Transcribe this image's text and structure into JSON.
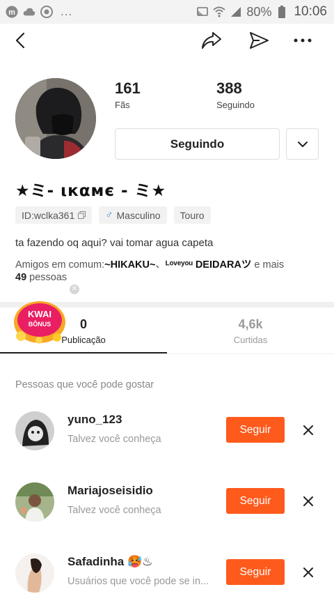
{
  "status_bar": {
    "battery_text": "80%",
    "time": "10:06",
    "dots": "...",
    "left_icons": [
      "messenger-icon",
      "cloud-icon",
      "chrome-icon"
    ],
    "right_icons": [
      "cast-icon",
      "wifi-icon",
      "signal-icon",
      "battery-icon"
    ]
  },
  "header": {
    "icons": [
      "back-icon",
      "share-icon",
      "send-icon",
      "more-icon"
    ]
  },
  "profile": {
    "followers_count": "161",
    "followers_label": "Fãs",
    "following_count": "388",
    "following_label": "Seguindo",
    "follow_button_label": "Seguindo",
    "username": "★ミ- ιкαмє - ミ★",
    "tags": {
      "id": "ID:wclka361",
      "gender_symbol": "♂",
      "gender": "Masculino",
      "sign": "Touro"
    },
    "bio": "ta fazendo oq aqui? vai tomar agua capeta",
    "mutual_friends": {
      "prefix": "Amigos em comum:",
      "friend_1": "~HIKAKU~",
      "separator": "、",
      "friend_2_small": "ᴸᵒᵛᵉ",
      "friend_2_small_b": "ʸᵒᵘ",
      "friend_2": "DEIDARA",
      "friend_2_suffix": "ツ",
      "and_more": " e mais",
      "count": "49",
      "people": " pessoas"
    }
  },
  "tabs": [
    {
      "count": "0",
      "label": "Publicação",
      "active": true
    },
    {
      "count": "4,6k",
      "label": "Curtidas",
      "active": false
    }
  ],
  "kwai_bonus": {
    "line1": "KWAI",
    "line2": "BÔNUS"
  },
  "suggestions": {
    "title": "Pessoas que você pode gostar",
    "button_label": "Seguir",
    "accent_color": "#fe5a1c",
    "items": [
      {
        "name": "yuno_123",
        "subtitle": "Talvez você conheça"
      },
      {
        "name": "Mariajoseisidio",
        "subtitle": "Talvez você conheça"
      },
      {
        "name": "Safadinha 🥵♨",
        "subtitle": "Usuários que você pode se in..."
      }
    ]
  }
}
